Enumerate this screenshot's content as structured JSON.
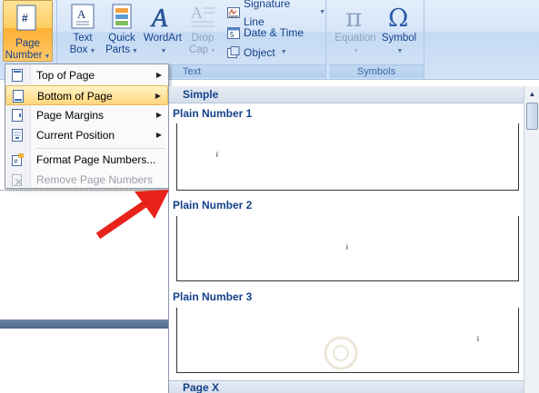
{
  "ribbon": {
    "page_number": {
      "line1": "Page",
      "line2": "Number"
    },
    "text_box": {
      "line1": "Text",
      "line2": "Box"
    },
    "quick_parts": {
      "line1": "Quick",
      "line2": "Parts"
    },
    "wordart": {
      "label": "WordArt"
    },
    "drop_cap": {
      "line1": "Drop",
      "line2": "Cap"
    },
    "signature_line": "Signature Line",
    "date_time": "Date & Time",
    "object": "Object",
    "text_group": "Text",
    "equation": "Equation",
    "symbol": "Symbol",
    "symbols_group": "Symbols"
  },
  "menu": {
    "items": [
      {
        "label": "Top of Page",
        "icon": "page-top-icon"
      },
      {
        "label": "Bottom of Page",
        "icon": "page-bottom-icon"
      },
      {
        "label": "Page Margins",
        "icon": "page-margins-icon"
      },
      {
        "label": "Current Position",
        "icon": "current-position-icon"
      },
      {
        "label": "Format Page Numbers...",
        "icon": "format-page-numbers-icon"
      },
      {
        "label": "Remove Page Numbers",
        "icon": "remove-page-numbers-icon"
      }
    ]
  },
  "gallery": {
    "section": "Simple",
    "items": [
      {
        "label": "Plain Number 1",
        "mark": "i"
      },
      {
        "label": "Plain Number 2",
        "mark": "i"
      },
      {
        "label": "Plain Number 3",
        "mark": "i"
      }
    ],
    "next_section": "Page X"
  },
  "colors": {
    "accent": "#15428b",
    "highlight": "#ffd67a",
    "arrow": "#e8231b"
  }
}
